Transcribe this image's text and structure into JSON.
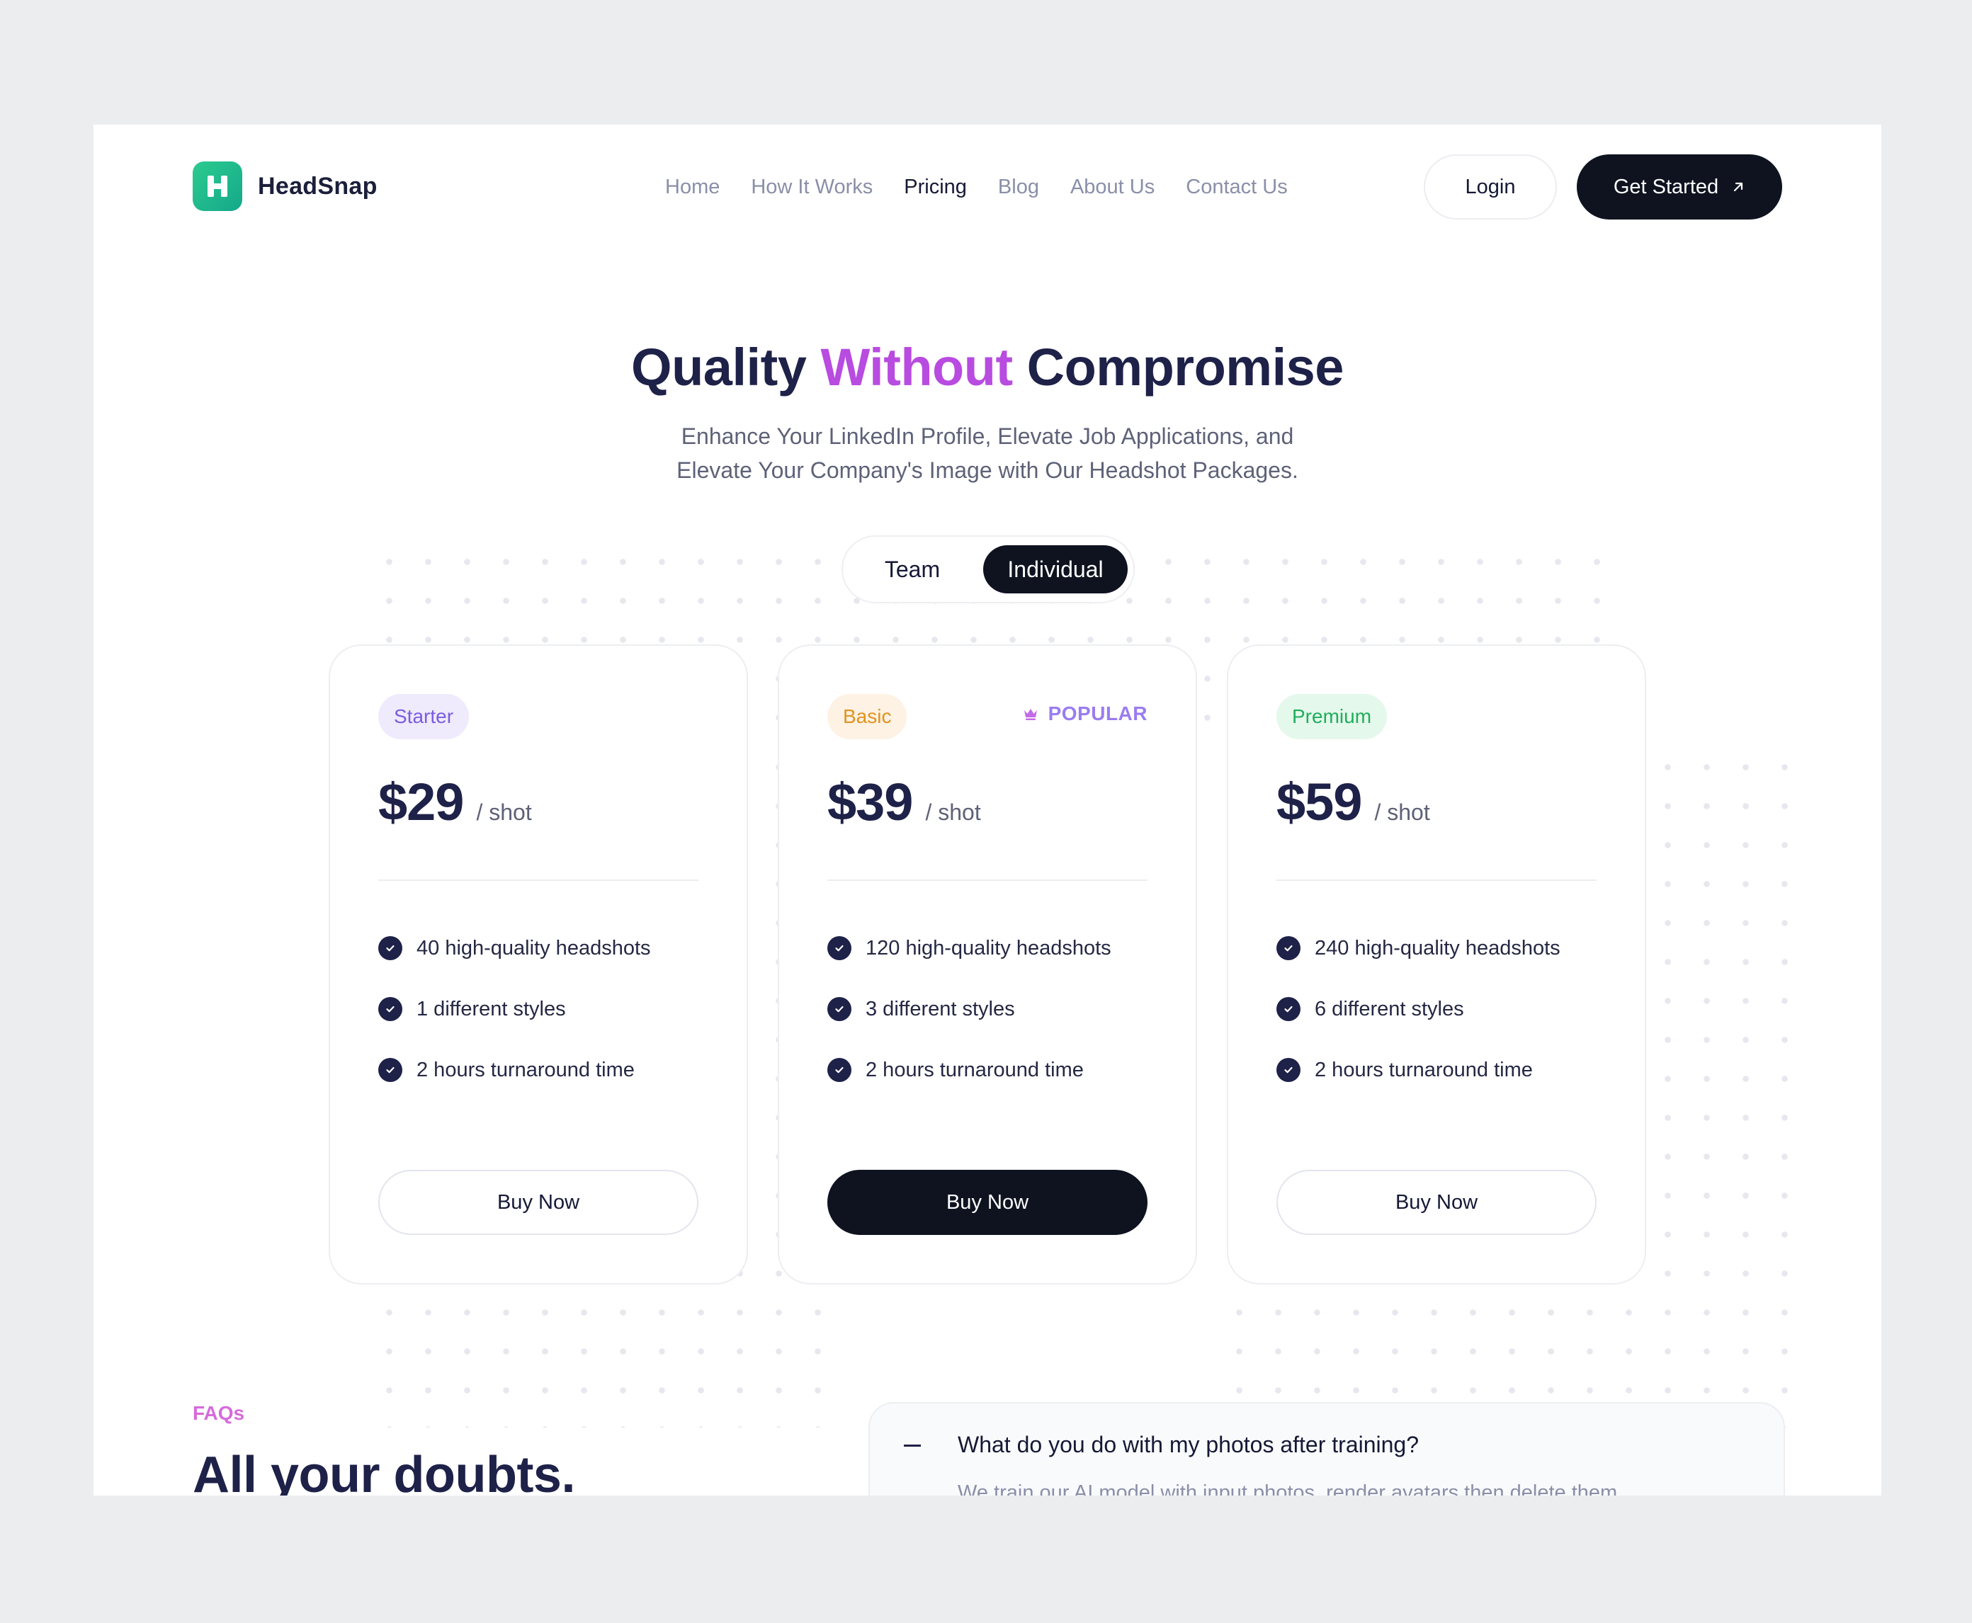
{
  "brand": {
    "name": "HeadSnap",
    "logo_letter": "H"
  },
  "nav": {
    "items": [
      {
        "label": "Home"
      },
      {
        "label": "How It Works"
      },
      {
        "label": "Pricing",
        "active": true
      },
      {
        "label": "Blog"
      },
      {
        "label": "About Us"
      },
      {
        "label": "Contact Us"
      }
    ],
    "login_label": "Login",
    "cta_label": "Get Started",
    "cta_icon": "arrow-up-right-icon"
  },
  "hero": {
    "title_part1": "Quality",
    "title_accent": "Without",
    "title_part2": "Compromise",
    "subtitle_line1": "Enhance Your LinkedIn Profile, Elevate Job Applications, and",
    "subtitle_line2": "Elevate Your Company's Image with Our Headshot Packages."
  },
  "toggle": {
    "options": [
      "Team",
      "Individual"
    ],
    "selected": "Individual"
  },
  "plans": [
    {
      "name": "Starter",
      "price": "$29",
      "unit": "/ shot",
      "features": [
        "40 high-quality headshots",
        "1 different styles",
        "2 hours turnaround time"
      ],
      "button": "Buy Now"
    },
    {
      "name": "Basic",
      "price": "$39",
      "unit": "/ shot",
      "popular_label": "POPULAR",
      "features": [
        "120 high-quality headshots",
        "3 different styles",
        "2 hours turnaround time"
      ],
      "button": "Buy Now"
    },
    {
      "name": "Premium",
      "price": "$59",
      "unit": "/ shot",
      "features": [
        "240 high-quality headshots",
        "6 different styles",
        "2 hours turnaround time"
      ],
      "button": "Buy Now"
    }
  ],
  "faq": {
    "label": "FAQs",
    "title": "All your doubts.",
    "items": [
      {
        "question": "What do you do with my photos after training?",
        "answer": "We train our AI model with input photos, render avatars then delete them"
      }
    ]
  },
  "colors": {
    "background": "#ECEDEF",
    "accent": "#B84BE0",
    "dark": "#0F1320",
    "brand_green": "#1DB98C",
    "starter_badge": "#EFEAFC",
    "basic_badge": "#FDF2E4",
    "premium_badge": "#E5F8EC"
  }
}
